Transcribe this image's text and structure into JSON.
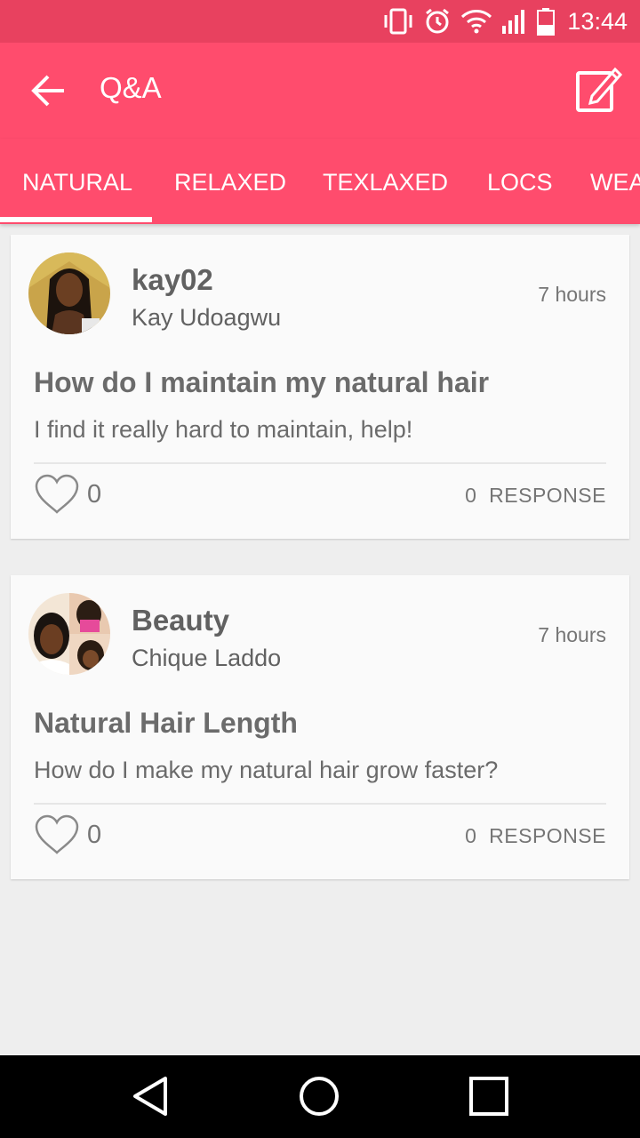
{
  "status_bar": {
    "time": "13:44",
    "icons": [
      "vibrate-icon",
      "alarm-icon",
      "wifi-icon",
      "signal-icon",
      "battery-icon"
    ],
    "color": "#e8415f"
  },
  "toolbar": {
    "title": "Q&A",
    "back_icon": "arrow-back-icon",
    "compose_icon": "compose-icon",
    "color": "#ff4c6d"
  },
  "tabs": {
    "items": [
      "NATURAL",
      "RELAXED",
      "TEXLAXED",
      "LOCS",
      "WEA"
    ],
    "selected": "NATURAL"
  },
  "posts": [
    {
      "username": "kay02",
      "full_name": "Kay Udoagwu",
      "time": "7 hours",
      "title": "How do I maintain my natural hair",
      "body": "I find it really hard to maintain, help!",
      "likes": "0",
      "response_count": "0",
      "response_label": "RESPONSE"
    },
    {
      "username": "Beauty",
      "full_name": "Chique Laddo",
      "time": "7 hours",
      "title": "Natural Hair Length",
      "body": "How do I make my natural hair grow faster?",
      "likes": "0",
      "response_count": "0",
      "response_label": "RESPONSE"
    }
  ],
  "nav_bar": {
    "icons": [
      "back-triangle-icon",
      "home-circle-icon",
      "recents-square-icon"
    ]
  }
}
